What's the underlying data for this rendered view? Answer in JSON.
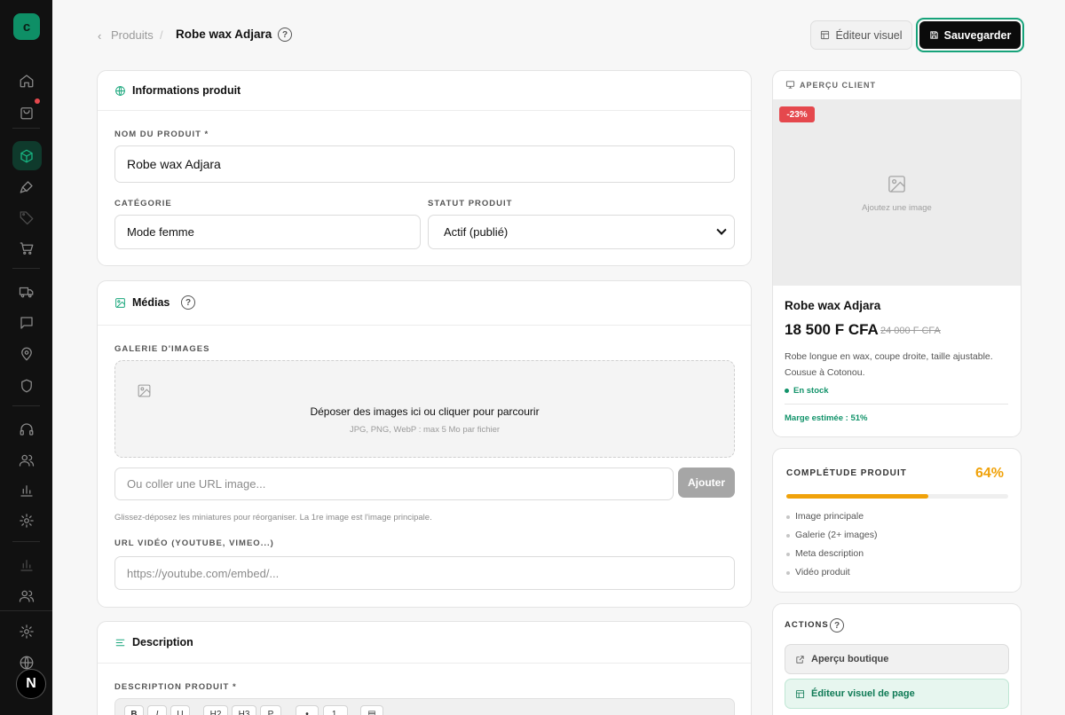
{
  "sidebar": {
    "logo_letter": "c",
    "avatar_letter": "N"
  },
  "header": {
    "breadcrumb_parent": "Produits",
    "breadcrumb_sep": "/",
    "page_title": "Robe wax Adjara",
    "visual_editor_label": "Éditeur visuel",
    "save_label": "Sauvegarder"
  },
  "info_card": {
    "title": "Informations produit",
    "name_label": "NOM DU PRODUIT *",
    "name_value": "Robe wax Adjara",
    "category_label": "CATÉGORIE",
    "category_value": "Mode femme",
    "status_label": "STATUT PRODUIT",
    "status_value": "Actif (publié)"
  },
  "media_card": {
    "title": "Médias",
    "gallery_label": "GALERIE D'IMAGES",
    "drop_text": "Déposer des images ici ou cliquer pour parcourir",
    "drop_sub": "JPG, PNG, WebP : max 5 Mo par fichier",
    "url_placeholder": "Ou coller une URL image...",
    "add_label": "Ajouter",
    "hint": "Glissez-déposez les miniatures pour réorganiser. La 1re image est l'image principale.",
    "video_label": "URL VIDÉO (YOUTUBE, VIMEO...)",
    "video_placeholder": "https://youtube.com/embed/..."
  },
  "desc_card": {
    "title": "Description",
    "desc_label": "DESCRIPTION PRODUIT *",
    "toolbar": [
      "B",
      "I",
      "U",
      "H2",
      "H3",
      "P",
      "•",
      "1.",
      "▤"
    ]
  },
  "preview": {
    "label": "APERÇU CLIENT",
    "discount_badge": "-23%",
    "image_placeholder": "Ajoutez une image",
    "name": "Robe wax Adjara",
    "price": "18 500 F CFA",
    "old_price": "24 000 F CFA",
    "description": "Robe longue en wax, coupe droite, taille ajustable. Cousue à Cotonou.",
    "stock": "En stock",
    "margin": "Marge estimée : 51%"
  },
  "completeness": {
    "label": "COMPLÉTUDE PRODUIT",
    "percent_text": "64%",
    "percent": 64,
    "items": [
      "Image principale",
      "Galerie (2+ images)",
      "Meta description",
      "Vidéo produit"
    ]
  },
  "actions": {
    "label": "ACTIONS",
    "boutique_preview": "Aperçu boutique",
    "page_editor": "Éditeur visuel de page"
  },
  "colors": {
    "accent": "#18a67b",
    "sidebar_bg": "#111111",
    "warning": "#f0a20a",
    "danger": "#e5484d"
  }
}
